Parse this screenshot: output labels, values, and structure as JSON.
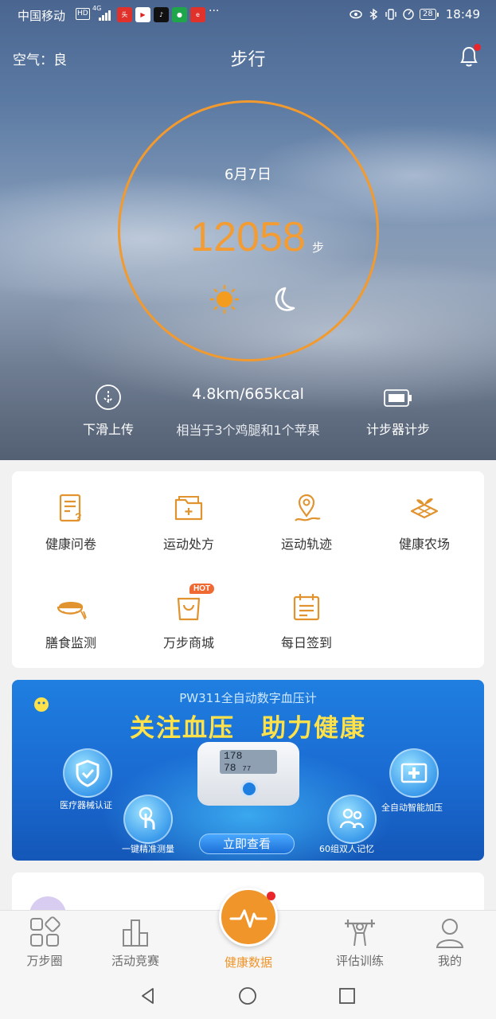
{
  "status_bar": {
    "carrier": "中国移动",
    "hd": "HD",
    "network": "4G",
    "more": "···",
    "battery": "28",
    "time": "18:49"
  },
  "header": {
    "air_quality": "空气：良",
    "title": "步行"
  },
  "step_ring": {
    "date": "6月7日",
    "steps": "12058",
    "unit": "步"
  },
  "stats": {
    "slide_upload": "下滑上传",
    "distance_calories": "4.8km/665kcal",
    "equivalent": "相当于3个鸡腿和1个苹果",
    "pedometer": "计步器计步"
  },
  "features": [
    {
      "label": "健康问卷",
      "icon": "questionnaire-icon"
    },
    {
      "label": "运动处方",
      "icon": "prescription-folder-icon"
    },
    {
      "label": "运动轨迹",
      "icon": "location-track-icon"
    },
    {
      "label": "健康农场",
      "icon": "farm-icon"
    },
    {
      "label": "膳食监测",
      "icon": "meal-bowl-icon"
    },
    {
      "label": "万步商城",
      "icon": "shopping-bag-icon"
    },
    {
      "label": "每日签到",
      "icon": "calendar-checkin-icon"
    }
  ],
  "hot_badge": "HOT",
  "banner": {
    "subtitle": "PW311全自动数字血压计",
    "headline": "关注血压　助力健康",
    "features": [
      "医疗器械认证",
      "一键精准测量",
      "60组双人记忆",
      "全自动智能加压"
    ],
    "display": [
      "178",
      "78",
      "77"
    ],
    "cta": "立即查看"
  },
  "nav": [
    {
      "label": "万步圈"
    },
    {
      "label": "活动竞赛"
    },
    {
      "label": "健康数据"
    },
    {
      "label": "评估训练"
    },
    {
      "label": "我的"
    }
  ],
  "colors": {
    "accent": "#f29a2e",
    "icon_orange": "#e0932f",
    "badge_red": "#e8262c"
  }
}
